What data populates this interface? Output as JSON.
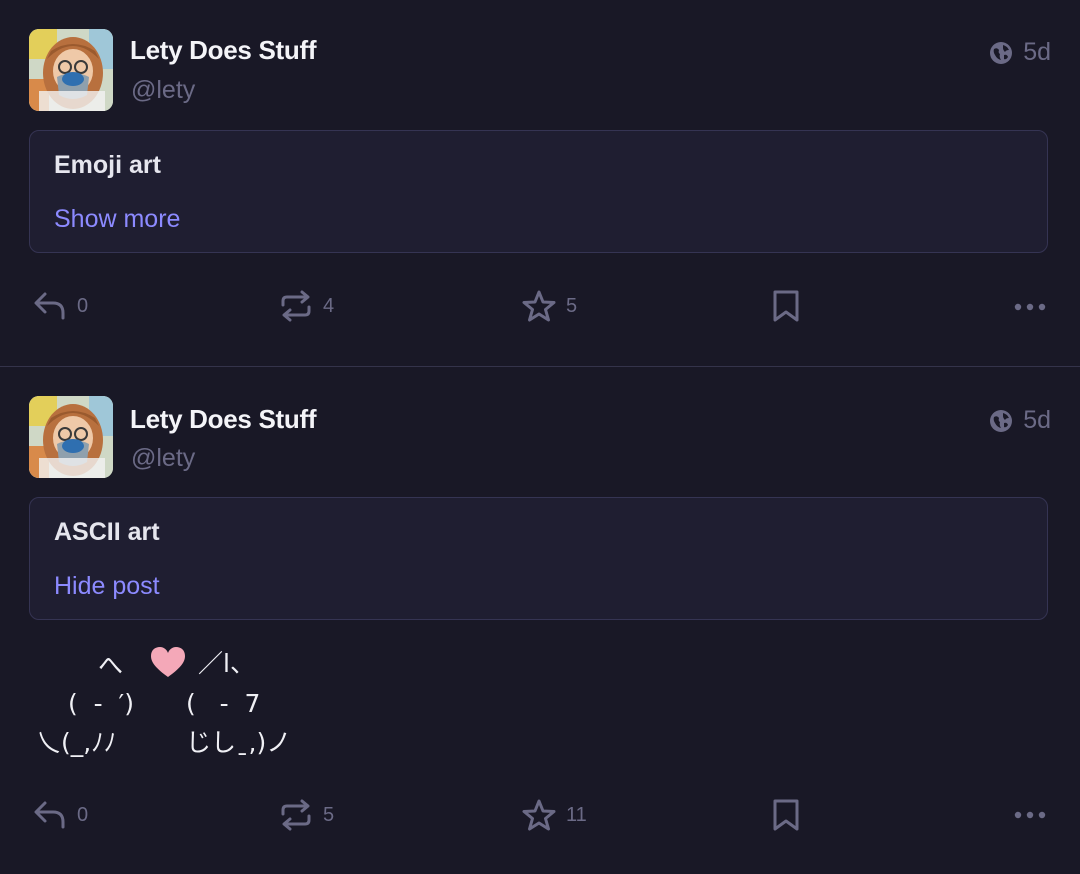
{
  "posts": [
    {
      "author": {
        "display_name": "Lety Does Stuff",
        "handle": "@lety",
        "avatar": "avatar-image"
      },
      "visibility_icon": "globe-icon",
      "time": "5d",
      "content_warning": "Emoji art",
      "toggle_label": "Show more",
      "actions": {
        "replies": "0",
        "boosts": "4",
        "favourites": "5"
      }
    },
    {
      "author": {
        "display_name": "Lety Does Stuff",
        "handle": "@lety",
        "avatar": "avatar-image"
      },
      "visibility_icon": "globe-icon",
      "time": "5d",
      "content_warning": "ASCII art",
      "toggle_label": "Hide post",
      "ascii_art": {
        "line1_left": "へ",
        "line1_right": "／l、",
        "line2_left": "(  -  ′)",
        "line2_right": "(   -  7",
        "line3_left": "乀(_,ﾉﾉ",
        "line3_right": "じしˍ,)ノ",
        "heart": "heart-emoji"
      },
      "actions": {
        "replies": "0",
        "boosts": "5",
        "favourites": "11"
      }
    }
  ],
  "colors": {
    "background": "#191826",
    "card": "#1f1e31",
    "accent": "#8c8aff",
    "muted": "#6b6a86",
    "heart": "#f4a8b8"
  }
}
